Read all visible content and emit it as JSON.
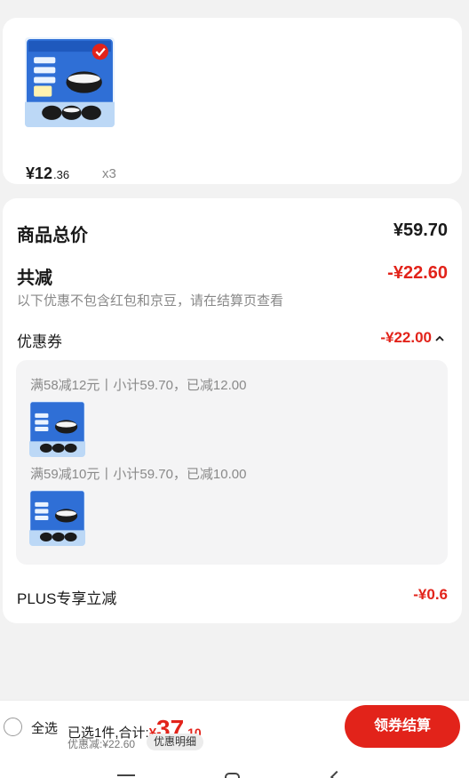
{
  "product": {
    "price_symbol": "¥",
    "price_integer": "12",
    "price_decimal": ".36",
    "quantity": "x3"
  },
  "summary": {
    "total_label": "商品总价",
    "total_value": "¥59.70",
    "reduction_label": "共减",
    "reduction_value": "-¥22.60",
    "note": "以下优惠不包含红包和京豆，请在结算页查看",
    "coupon_label": "优惠券",
    "coupon_value": "-¥22.00",
    "coupons": [
      {
        "text": "满58减12元丨小计59.70，已减12.00"
      },
      {
        "text": "满59减10元丨小计59.70，已减10.00"
      }
    ],
    "plus_label": "PLUS专享立减",
    "plus_value": "-¥0.6"
  },
  "bottom_bar": {
    "select_all": "全选",
    "selected_text": "已选1件,合计:",
    "total_symbol": "¥",
    "total_integer": "37",
    "total_decimal": ".10",
    "discount_text": "优惠减:¥22.60",
    "detail_button": "优惠明细",
    "checkout_button": "领券结算"
  },
  "colors": {
    "accent_red": "#e2231a",
    "product_blue": "#2f6fd6"
  },
  "icons": {
    "coupon_toggle": "chevron-up-icon",
    "checked": "check-badge-icon"
  }
}
